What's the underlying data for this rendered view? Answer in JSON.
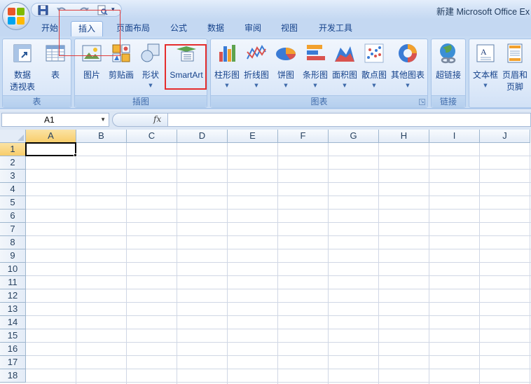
{
  "window": {
    "title": "新建 Microsoft Office Ex"
  },
  "quick_access": {
    "icons": [
      "save-icon",
      "undo-icon",
      "redo-icon",
      "print-preview-icon",
      "customize-dropdown-icon"
    ]
  },
  "tabs": [
    {
      "label": "开始",
      "active": false
    },
    {
      "label": "插入",
      "active": true
    },
    {
      "label": "页面布局",
      "active": false
    },
    {
      "label": "公式",
      "active": false
    },
    {
      "label": "数据",
      "active": false
    },
    {
      "label": "审阅",
      "active": false
    },
    {
      "label": "视图",
      "active": false
    },
    {
      "label": "开发工具",
      "active": false
    }
  ],
  "ribbon": {
    "groups": {
      "tables": {
        "label": "表",
        "pivot_label_1": "数据",
        "pivot_label_2": "透视表",
        "table_label": "表"
      },
      "illustrations": {
        "label": "插图",
        "picture_label": "图片",
        "clipart_label": "剪贴画",
        "shapes_label": "形状",
        "smartart_label": "SmartArt"
      },
      "charts": {
        "label": "图表",
        "column_label": "柱形图",
        "line_label": "折线图",
        "pie_label": "饼图",
        "bar_label": "条形图",
        "area_label": "面积图",
        "scatter_label": "散点图",
        "other_label": "其他图表"
      },
      "links": {
        "label": "链接",
        "hyperlink_label": "超链接"
      },
      "text": {
        "textbox_label": "文本框",
        "header_footer_label_1": "页眉和",
        "header_footer_label_2": "页脚"
      }
    },
    "highlighted_command": "SmartArt",
    "highlight_color": "#e52d2d"
  },
  "formula_bar": {
    "name_box": "A1",
    "fx": "fx",
    "formula": ""
  },
  "grid": {
    "columns": [
      "A",
      "B",
      "C",
      "D",
      "E",
      "F",
      "G",
      "H",
      "I",
      "J"
    ],
    "rows": [
      "1",
      "2",
      "3",
      "4",
      "5",
      "6",
      "7",
      "8",
      "9",
      "10",
      "11",
      "12",
      "13",
      "14",
      "15",
      "16",
      "17",
      "18"
    ],
    "active_cell": "A1",
    "selection_color": "#f8cd6b"
  },
  "colors": {
    "ribbon_bg": "#c7dbf3",
    "text": "#15428b",
    "gridline": "#d0d7e5"
  }
}
